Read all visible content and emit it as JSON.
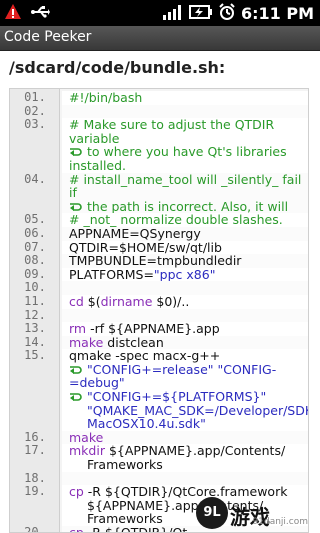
{
  "status_bar": {
    "time": "6:11 PM",
    "icons": [
      "warning-icon",
      "usb-icon",
      "signal-icon",
      "battery-charging-icon",
      "alarm-icon"
    ]
  },
  "app": {
    "title": "Code Peeker"
  },
  "file": {
    "path": "/sdcard/code/bundle.sh:"
  },
  "code_lines": [
    {
      "num": "01.",
      "parts": [
        {
          "t": "#!/bin/bash",
          "c": "comment"
        }
      ]
    },
    {
      "num": "02.",
      "parts": []
    },
    {
      "num": "03.",
      "parts": [
        {
          "t": "# Make sure to adjust the QTDIR variable",
          "c": "comment"
        }
      ],
      "wrap": [
        {
          "t": "to where you have Qt's libraries installed.",
          "c": "comment"
        }
      ]
    },
    {
      "num": "04.",
      "parts": [
        {
          "t": "# install_name_tool will _silently_ fail if",
          "c": "comment"
        }
      ],
      "wrap": [
        {
          "t": "the path is incorrect. Also, it will",
          "c": "comment"
        }
      ]
    },
    {
      "num": "05.",
      "parts": [
        {
          "t": "# _not_ normalize double slashes.",
          "c": "comment"
        }
      ]
    },
    {
      "num": "06.",
      "parts": [
        {
          "t": "APPNAME=QSynergy",
          "c": "plain"
        }
      ]
    },
    {
      "num": "07.",
      "parts": [
        {
          "t": "QTDIR=$HOME/sw/qt/lib",
          "c": "plain"
        }
      ]
    },
    {
      "num": "08.",
      "parts": [
        {
          "t": "TMPBUNDLE=tmpbundledir",
          "c": "plain"
        }
      ]
    },
    {
      "num": "09.",
      "parts": [
        {
          "t": "PLATFORMS=",
          "c": "plain"
        },
        {
          "t": "\"ppc x86\"",
          "c": "string"
        }
      ]
    },
    {
      "num": "10.",
      "parts": []
    },
    {
      "num": "11.",
      "parts": [
        {
          "t": "cd ",
          "c": "keyword"
        },
        {
          "t": "$(",
          "c": "plain"
        },
        {
          "t": "dirname",
          "c": "keyword"
        },
        {
          "t": " $0)/..",
          "c": "plain"
        }
      ]
    },
    {
      "num": "12.",
      "parts": []
    },
    {
      "num": "13.",
      "parts": [
        {
          "t": "rm",
          "c": "keyword"
        },
        {
          "t": " -rf ${APPNAME}.app",
          "c": "plain"
        }
      ]
    },
    {
      "num": "14.",
      "parts": [
        {
          "t": "make",
          "c": "keyword"
        },
        {
          "t": " distclean",
          "c": "plain"
        }
      ]
    },
    {
      "num": "15.",
      "parts": [
        {
          "t": "qmake -spec macx-g++",
          "c": "plain"
        }
      ],
      "wrap": [
        {
          "t": "\"CONFIG+=release\" \"CONFIG-=debug\"",
          "c": "string"
        }
      ],
      "wrap2": [
        {
          "t": "\"CONFIG+=${PLATFORMS}\"",
          "c": "string"
        }
      ],
      "cont": [
        {
          "t": "\"QMAKE_MAC_SDK=/Developer/SDKs/",
          "c": "string"
        }
      ],
      "cont2": [
        {
          "t": "MacOSX10.4u.sdk\"",
          "c": "string"
        }
      ]
    },
    {
      "num": "16.",
      "parts": [
        {
          "t": "make",
          "c": "keyword"
        }
      ]
    },
    {
      "num": "17.",
      "parts": [
        {
          "t": "mkdir",
          "c": "keyword"
        },
        {
          "t": " ${APPNAME}.app/Contents/",
          "c": "plain"
        }
      ],
      "cont": [
        {
          "t": "Frameworks",
          "c": "plain"
        }
      ]
    },
    {
      "num": "18.",
      "parts": []
    },
    {
      "num": "19.",
      "parts": [
        {
          "t": "cp",
          "c": "keyword"
        },
        {
          "t": " -R ${QTDIR}/QtCore.framework",
          "c": "plain"
        }
      ],
      "cont": [
        {
          "t": "${APPNAME}.app/Contents/",
          "c": "plain"
        }
      ],
      "cont2": [
        {
          "t": "Frameworks",
          "c": "plain"
        }
      ]
    },
    {
      "num": "20.",
      "parts": [
        {
          "t": "cp",
          "c": "keyword"
        },
        {
          "t": " -R ${QTDIR}/Qt...",
          "c": "plain"
        }
      ],
      "cont": [
        {
          "t": "${APPNAME}.app/Cont...",
          "c": "plain"
        }
      ]
    }
  ],
  "watermark": {
    "badge": "9L",
    "text": "游戏",
    "sub": "91danji.com"
  }
}
